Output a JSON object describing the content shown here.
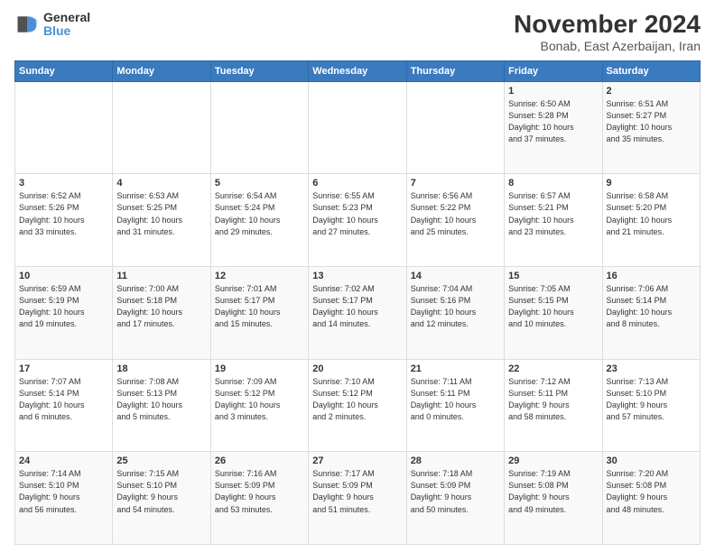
{
  "header": {
    "logo_general": "General",
    "logo_blue": "Blue",
    "month_title": "November 2024",
    "location": "Bonab, East Azerbaijan, Iran"
  },
  "calendar": {
    "days_of_week": [
      "Sunday",
      "Monday",
      "Tuesday",
      "Wednesday",
      "Thursday",
      "Friday",
      "Saturday"
    ],
    "weeks": [
      [
        {
          "day": "",
          "content": ""
        },
        {
          "day": "",
          "content": ""
        },
        {
          "day": "",
          "content": ""
        },
        {
          "day": "",
          "content": ""
        },
        {
          "day": "",
          "content": ""
        },
        {
          "day": "1",
          "content": "Sunrise: 6:50 AM\nSunset: 5:28 PM\nDaylight: 10 hours\nand 37 minutes."
        },
        {
          "day": "2",
          "content": "Sunrise: 6:51 AM\nSunset: 5:27 PM\nDaylight: 10 hours\nand 35 minutes."
        }
      ],
      [
        {
          "day": "3",
          "content": "Sunrise: 6:52 AM\nSunset: 5:26 PM\nDaylight: 10 hours\nand 33 minutes."
        },
        {
          "day": "4",
          "content": "Sunrise: 6:53 AM\nSunset: 5:25 PM\nDaylight: 10 hours\nand 31 minutes."
        },
        {
          "day": "5",
          "content": "Sunrise: 6:54 AM\nSunset: 5:24 PM\nDaylight: 10 hours\nand 29 minutes."
        },
        {
          "day": "6",
          "content": "Sunrise: 6:55 AM\nSunset: 5:23 PM\nDaylight: 10 hours\nand 27 minutes."
        },
        {
          "day": "7",
          "content": "Sunrise: 6:56 AM\nSunset: 5:22 PM\nDaylight: 10 hours\nand 25 minutes."
        },
        {
          "day": "8",
          "content": "Sunrise: 6:57 AM\nSunset: 5:21 PM\nDaylight: 10 hours\nand 23 minutes."
        },
        {
          "day": "9",
          "content": "Sunrise: 6:58 AM\nSunset: 5:20 PM\nDaylight: 10 hours\nand 21 minutes."
        }
      ],
      [
        {
          "day": "10",
          "content": "Sunrise: 6:59 AM\nSunset: 5:19 PM\nDaylight: 10 hours\nand 19 minutes."
        },
        {
          "day": "11",
          "content": "Sunrise: 7:00 AM\nSunset: 5:18 PM\nDaylight: 10 hours\nand 17 minutes."
        },
        {
          "day": "12",
          "content": "Sunrise: 7:01 AM\nSunset: 5:17 PM\nDaylight: 10 hours\nand 15 minutes."
        },
        {
          "day": "13",
          "content": "Sunrise: 7:02 AM\nSunset: 5:17 PM\nDaylight: 10 hours\nand 14 minutes."
        },
        {
          "day": "14",
          "content": "Sunrise: 7:04 AM\nSunset: 5:16 PM\nDaylight: 10 hours\nand 12 minutes."
        },
        {
          "day": "15",
          "content": "Sunrise: 7:05 AM\nSunset: 5:15 PM\nDaylight: 10 hours\nand 10 minutes."
        },
        {
          "day": "16",
          "content": "Sunrise: 7:06 AM\nSunset: 5:14 PM\nDaylight: 10 hours\nand 8 minutes."
        }
      ],
      [
        {
          "day": "17",
          "content": "Sunrise: 7:07 AM\nSunset: 5:14 PM\nDaylight: 10 hours\nand 6 minutes."
        },
        {
          "day": "18",
          "content": "Sunrise: 7:08 AM\nSunset: 5:13 PM\nDaylight: 10 hours\nand 5 minutes."
        },
        {
          "day": "19",
          "content": "Sunrise: 7:09 AM\nSunset: 5:12 PM\nDaylight: 10 hours\nand 3 minutes."
        },
        {
          "day": "20",
          "content": "Sunrise: 7:10 AM\nSunset: 5:12 PM\nDaylight: 10 hours\nand 2 minutes."
        },
        {
          "day": "21",
          "content": "Sunrise: 7:11 AM\nSunset: 5:11 PM\nDaylight: 10 hours\nand 0 minutes."
        },
        {
          "day": "22",
          "content": "Sunrise: 7:12 AM\nSunset: 5:11 PM\nDaylight: 9 hours\nand 58 minutes."
        },
        {
          "day": "23",
          "content": "Sunrise: 7:13 AM\nSunset: 5:10 PM\nDaylight: 9 hours\nand 57 minutes."
        }
      ],
      [
        {
          "day": "24",
          "content": "Sunrise: 7:14 AM\nSunset: 5:10 PM\nDaylight: 9 hours\nand 56 minutes."
        },
        {
          "day": "25",
          "content": "Sunrise: 7:15 AM\nSunset: 5:10 PM\nDaylight: 9 hours\nand 54 minutes."
        },
        {
          "day": "26",
          "content": "Sunrise: 7:16 AM\nSunset: 5:09 PM\nDaylight: 9 hours\nand 53 minutes."
        },
        {
          "day": "27",
          "content": "Sunrise: 7:17 AM\nSunset: 5:09 PM\nDaylight: 9 hours\nand 51 minutes."
        },
        {
          "day": "28",
          "content": "Sunrise: 7:18 AM\nSunset: 5:09 PM\nDaylight: 9 hours\nand 50 minutes."
        },
        {
          "day": "29",
          "content": "Sunrise: 7:19 AM\nSunset: 5:08 PM\nDaylight: 9 hours\nand 49 minutes."
        },
        {
          "day": "30",
          "content": "Sunrise: 7:20 AM\nSunset: 5:08 PM\nDaylight: 9 hours\nand 48 minutes."
        }
      ]
    ]
  }
}
